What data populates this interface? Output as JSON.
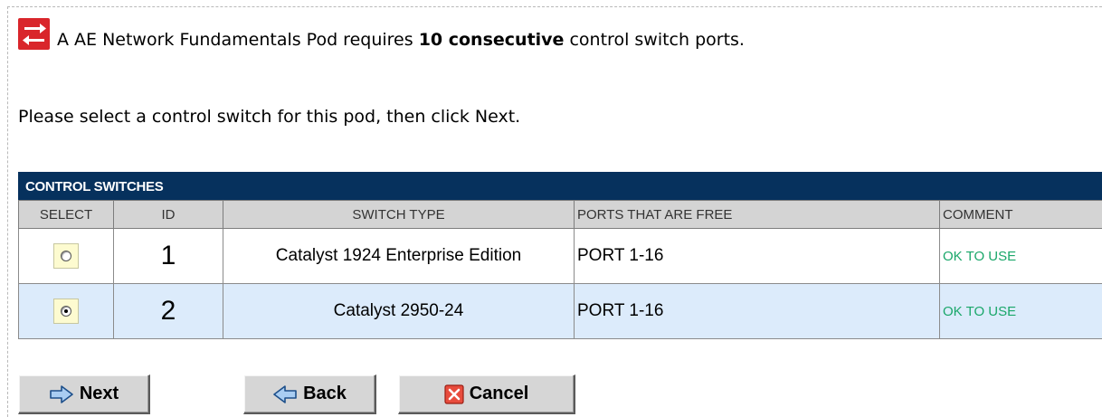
{
  "intro": {
    "before": "A AE Network Fundamentals Pod requires",
    "bold": "10 consecutive",
    "after": "control switch ports."
  },
  "instruction": "Please select a control switch for this pod, then click Next.",
  "table": {
    "title": "CONTROL SWITCHES",
    "headers": {
      "select": "SELECT",
      "id": "ID",
      "switch_type": "SWITCH TYPE",
      "ports": "PORTS THAT ARE FREE",
      "comment": "COMMENT"
    },
    "rows": [
      {
        "selected": false,
        "id": "1",
        "switch_type": "Catalyst 1924 Enterprise Edition",
        "ports": "PORT 1-16",
        "comment": "OK TO USE"
      },
      {
        "selected": true,
        "id": "2",
        "switch_type": "Catalyst 2950-24",
        "ports": "PORT 1-16",
        "comment": "OK TO USE"
      }
    ]
  },
  "buttons": {
    "next": "Next",
    "back": "Back",
    "cancel": "Cancel"
  },
  "icons": {
    "pod": "switch-arrows-icon",
    "next": "arrow-right-icon",
    "back": "arrow-left-icon",
    "cancel": "cancel-x-icon"
  },
  "colors": {
    "table_title_bg": "#06315d",
    "row_highlight": "#dcebfb",
    "comment_ok": "#1aa76a",
    "pod_icon": "#d9262b"
  }
}
